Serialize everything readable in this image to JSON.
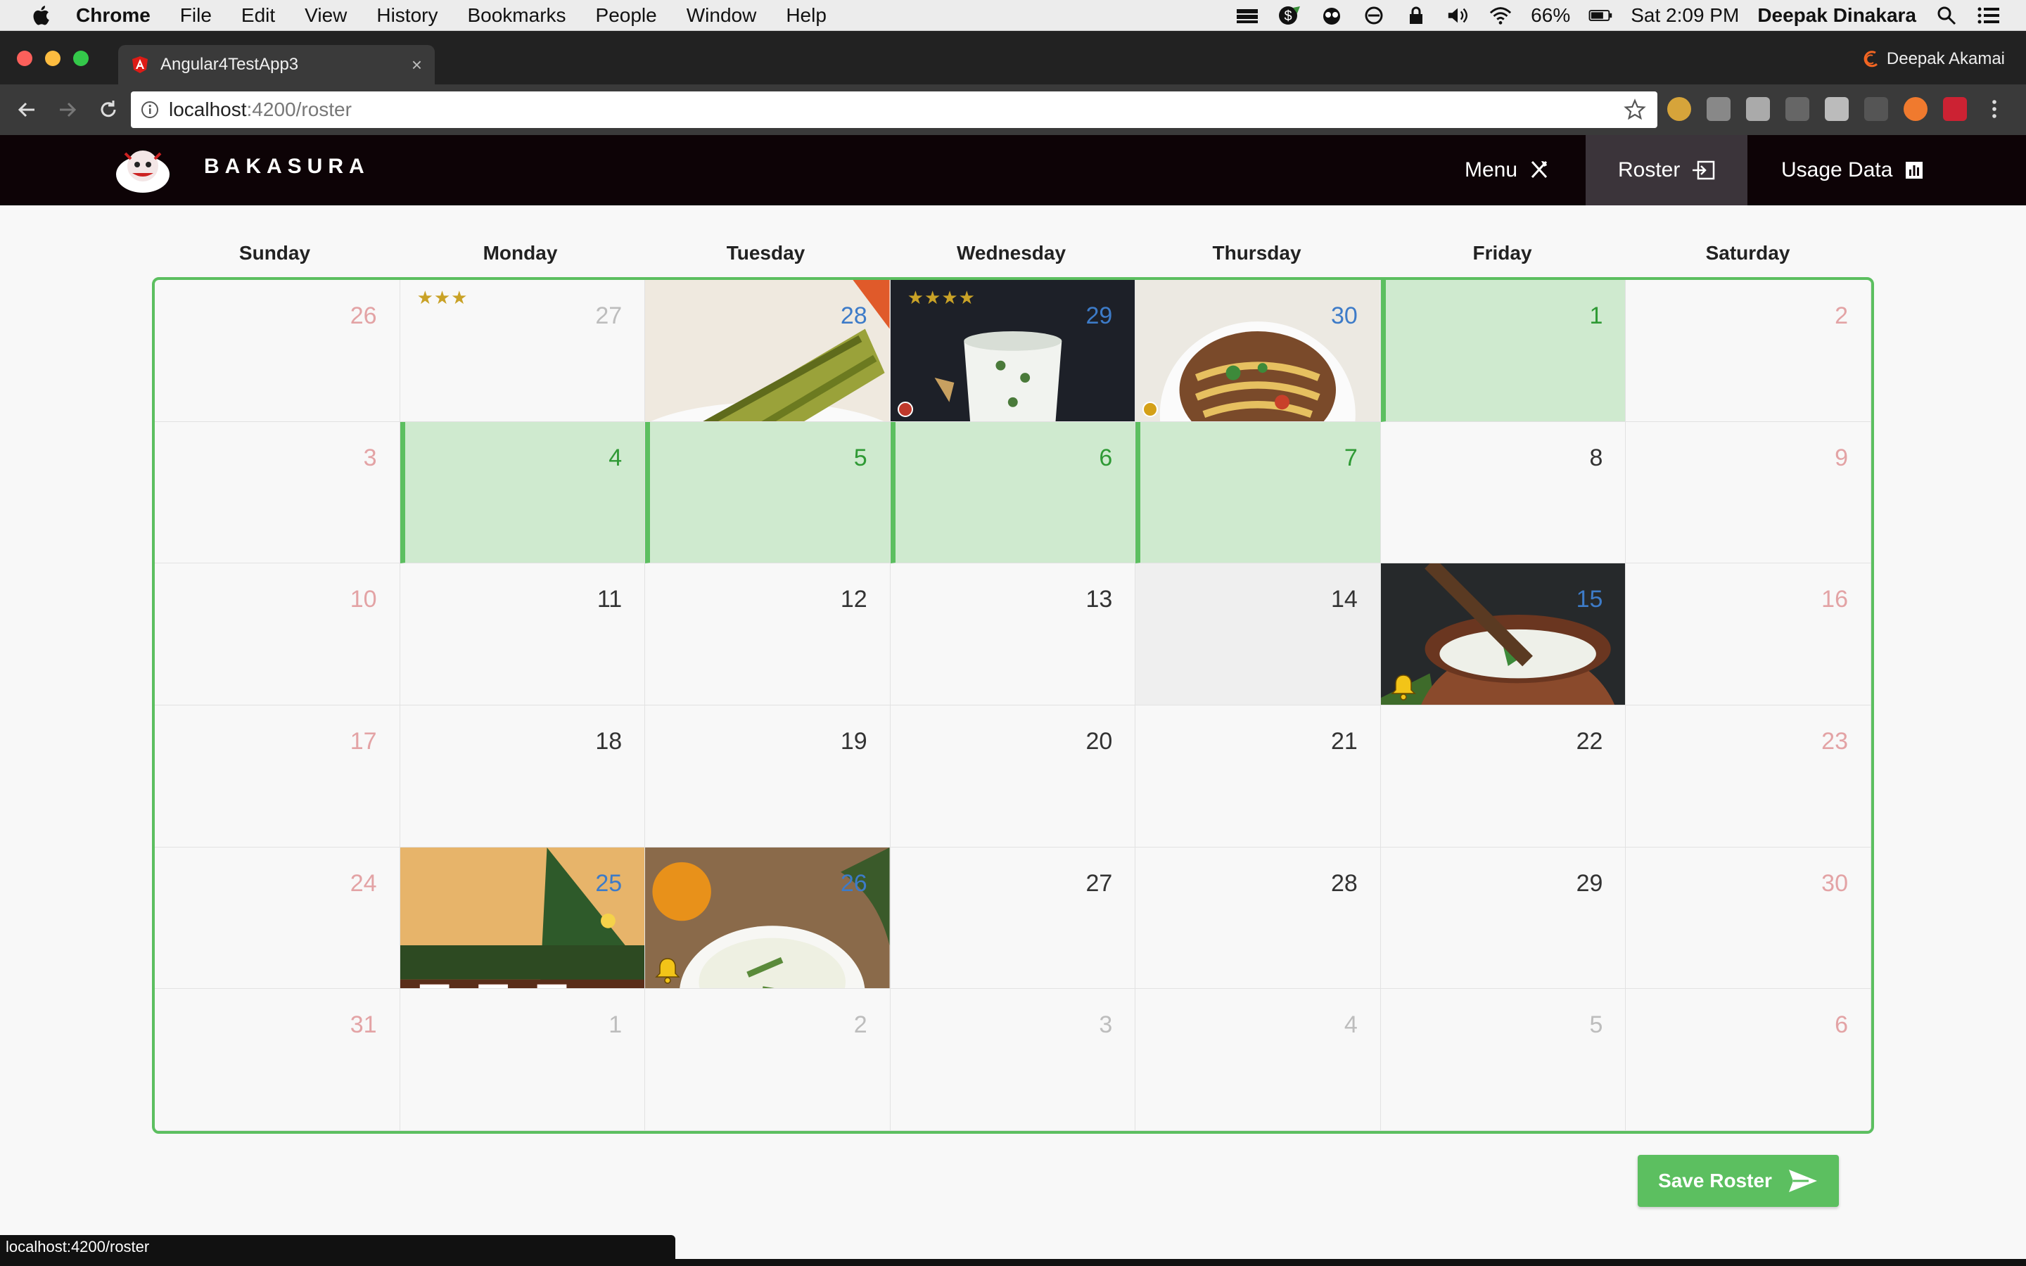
{
  "macos_menubar": {
    "app_name": "Chrome",
    "menus": [
      "File",
      "Edit",
      "View",
      "History",
      "Bookmarks",
      "People",
      "Window",
      "Help"
    ],
    "battery": "66%",
    "clock": "Sat 2:09 PM",
    "user": "Deepak Dinakara"
  },
  "browser": {
    "tab_title": "Angular4TestApp3",
    "profile_name": "Deepak Akamai",
    "url_host": "localhost",
    "url_path": ":4200/roster",
    "status_url": "localhost:4200/roster"
  },
  "app": {
    "brand": "BAKASURA",
    "nav": [
      {
        "label": "Menu",
        "icon": "fork-knife-icon"
      },
      {
        "label": "Roster",
        "icon": "sign-in-icon",
        "active": true
      },
      {
        "label": "Usage Data",
        "icon": "bar-chart-icon"
      }
    ]
  },
  "calendar": {
    "weekdays": [
      "Sunday",
      "Monday",
      "Tuesday",
      "Wednesday",
      "Thursday",
      "Friday",
      "Saturday"
    ],
    "weeks": [
      [
        {
          "day": "26",
          "kind": "other weekend"
        },
        {
          "day": "27",
          "kind": "other",
          "stars": "★★★"
        },
        {
          "day": "28",
          "kind": "img",
          "image": "grilled-dhokla"
        },
        {
          "day": "29",
          "kind": "img",
          "image": "buttermilk-glass",
          "stars": "★★★★",
          "dot": "#c0392b"
        },
        {
          "day": "30",
          "kind": "img",
          "image": "noodle-soup",
          "dot": "#d4a017"
        },
        {
          "day": "1",
          "kind": "green bar"
        },
        {
          "day": "2",
          "kind": "other weekend"
        }
      ],
      [
        {
          "day": "3",
          "kind": "weekend"
        },
        {
          "day": "4",
          "kind": "green bar"
        },
        {
          "day": "5",
          "kind": "green bar"
        },
        {
          "day": "6",
          "kind": "green bar"
        },
        {
          "day": "7",
          "kind": "green bar"
        },
        {
          "day": "8",
          "kind": ""
        },
        {
          "day": "9",
          "kind": "weekend"
        }
      ],
      [
        {
          "day": "10",
          "kind": "weekend"
        },
        {
          "day": "11",
          "kind": ""
        },
        {
          "day": "12",
          "kind": ""
        },
        {
          "day": "13",
          "kind": ""
        },
        {
          "day": "14",
          "kind": "gray"
        },
        {
          "day": "15",
          "kind": "img",
          "image": "buttermilk-pot",
          "bell": true
        },
        {
          "day": "16",
          "kind": "weekend"
        }
      ],
      [
        {
          "day": "17",
          "kind": "weekend"
        },
        {
          "day": "18",
          "kind": ""
        },
        {
          "day": "19",
          "kind": ""
        },
        {
          "day": "20",
          "kind": ""
        },
        {
          "day": "21",
          "kind": ""
        },
        {
          "day": "22",
          "kind": ""
        },
        {
          "day": "23",
          "kind": "weekend"
        }
      ],
      [
        {
          "day": "24",
          "kind": "weekend"
        },
        {
          "day": "25",
          "kind": "img",
          "image": "christmas-stockings"
        },
        {
          "day": "26",
          "kind": "img",
          "image": "yogurt-soup",
          "bell": true
        },
        {
          "day": "27",
          "kind": ""
        },
        {
          "day": "28",
          "kind": ""
        },
        {
          "day": "29",
          "kind": ""
        },
        {
          "day": "30",
          "kind": "weekend"
        }
      ],
      [
        {
          "day": "31",
          "kind": "weekend"
        },
        {
          "day": "1",
          "kind": "other"
        },
        {
          "day": "2",
          "kind": "other"
        },
        {
          "day": "3",
          "kind": "other"
        },
        {
          "day": "4",
          "kind": "other"
        },
        {
          "day": "5",
          "kind": "other"
        },
        {
          "day": "6",
          "kind": "other weekend"
        }
      ]
    ]
  },
  "actions": {
    "save_label": "Save Roster"
  },
  "colors": {
    "accent_green": "#5cbf60",
    "selected_green": "#cfeacf",
    "nav_bg": "#0d0306",
    "weekend_red": "#e3a3a5",
    "image_day_blue": "#3d7bc8"
  }
}
